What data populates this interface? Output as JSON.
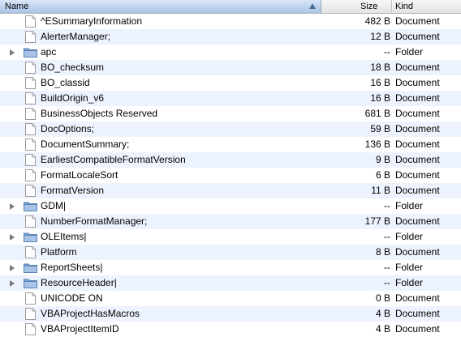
{
  "header": {
    "name": "Name",
    "size": "Size",
    "kind": "Kind"
  },
  "rows": [
    {
      "name": "^ESummaryInformation",
      "size": "482 B",
      "kind": "Document",
      "type": "file"
    },
    {
      "name": "AlerterManager;",
      "size": "12 B",
      "kind": "Document",
      "type": "file"
    },
    {
      "name": "apc",
      "size": "--",
      "kind": "Folder",
      "type": "folder"
    },
    {
      "name": "BO_checksum",
      "size": "18 B",
      "kind": "Document",
      "type": "file"
    },
    {
      "name": "BO_classid",
      "size": "16 B",
      "kind": "Document",
      "type": "file"
    },
    {
      "name": "BuildOrigin_v6",
      "size": "16 B",
      "kind": "Document",
      "type": "file"
    },
    {
      "name": "BusinessObjects Reserved",
      "size": "681 B",
      "kind": "Document",
      "type": "file"
    },
    {
      "name": "DocOptions;",
      "size": "59 B",
      "kind": "Document",
      "type": "file"
    },
    {
      "name": "DocumentSummary;",
      "size": "136 B",
      "kind": "Document",
      "type": "file"
    },
    {
      "name": "EarliestCompatibleFormatVersion",
      "size": "9 B",
      "kind": "Document",
      "type": "file"
    },
    {
      "name": "FormatLocaleSort",
      "size": "6 B",
      "kind": "Document",
      "type": "file"
    },
    {
      "name": "FormatVersion",
      "size": "11 B",
      "kind": "Document",
      "type": "file"
    },
    {
      "name": "GDM|",
      "size": "--",
      "kind": "Folder",
      "type": "folder"
    },
    {
      "name": "NumberFormatManager;",
      "size": "177 B",
      "kind": "Document",
      "type": "file"
    },
    {
      "name": "OLEItems|",
      "size": "--",
      "kind": "Folder",
      "type": "folder"
    },
    {
      "name": "Platform",
      "size": "8 B",
      "kind": "Document",
      "type": "file"
    },
    {
      "name": "ReportSheets|",
      "size": "--",
      "kind": "Folder",
      "type": "folder"
    },
    {
      "name": "ResourceHeader|",
      "size": "--",
      "kind": "Folder",
      "type": "folder"
    },
    {
      "name": "UNICODE ON",
      "size": "0 B",
      "kind": "Document",
      "type": "file"
    },
    {
      "name": "VBAProjectHasMacros",
      "size": "4 B",
      "kind": "Document",
      "type": "file"
    },
    {
      "name": "VBAProjectItemID",
      "size": "4 B",
      "kind": "Document",
      "type": "file"
    }
  ],
  "colors": {
    "stripe": "#edf3fe",
    "folder": "#8fb1d9",
    "header_selected": "#a9c3e6"
  }
}
